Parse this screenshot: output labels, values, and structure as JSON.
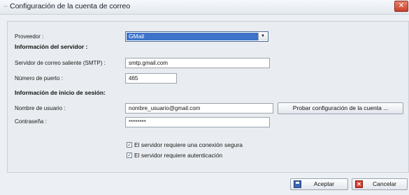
{
  "window": {
    "title": "Configuración de la cuenta de correo",
    "close_glyph": "✕"
  },
  "provider": {
    "label": "Proveedor :",
    "value": "GMail"
  },
  "server_section": {
    "title": "Información del servidor :"
  },
  "smtp": {
    "label": "Servidor de correo saliente (SMTP) :",
    "value": "smtp.gmail.com"
  },
  "port": {
    "label": "Número de puerto :",
    "value": "465"
  },
  "login_section": {
    "title": "Información de inicio de sesión:"
  },
  "username": {
    "label": "Nombre de usuario :",
    "value": "nombre_usuario@gmail.com"
  },
  "test_button": {
    "label": "Probar configuración de la cuenta ..."
  },
  "password": {
    "label": "Contraseña :",
    "value": "********"
  },
  "options": {
    "secure": {
      "label": "El servidor requiere una conexión segura",
      "checked": true
    },
    "auth": {
      "label": "El servidor requiere autenticación",
      "checked": true
    }
  },
  "footer": {
    "accept_label": "Aceptar",
    "cancel_label": "Cancelar"
  },
  "icons": {
    "accept": "save-icon",
    "cancel": "cancel-x-icon",
    "combo_arrow": "chevron-down-icon"
  }
}
